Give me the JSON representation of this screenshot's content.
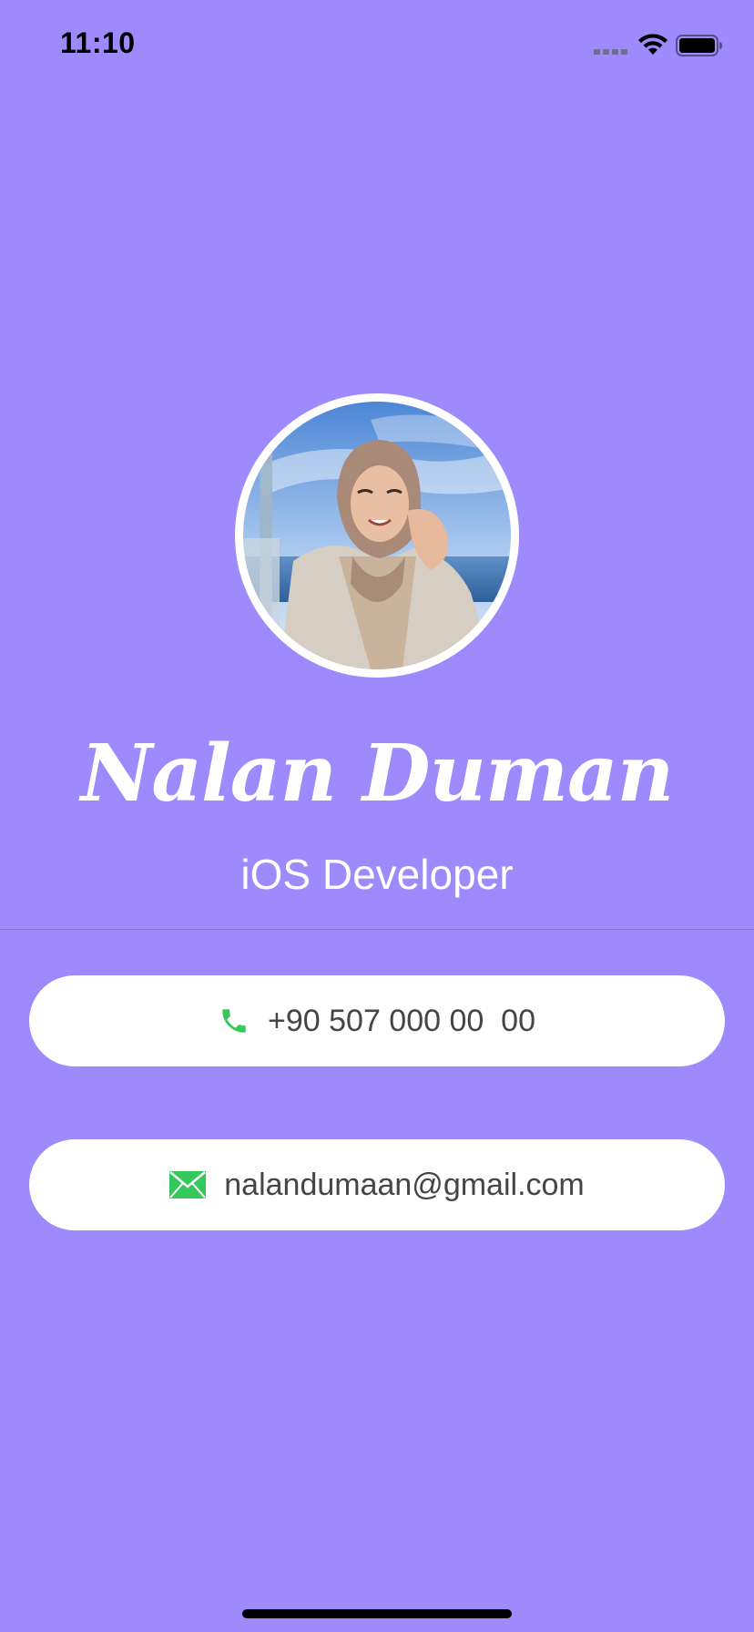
{
  "status_bar": {
    "time": "11:10"
  },
  "profile": {
    "name": "Nalan Duman",
    "title": "iOS Developer"
  },
  "contacts": {
    "phone": {
      "icon": "phone-icon",
      "value": "+90 507 000 00  00"
    },
    "email": {
      "icon": "envelope-icon",
      "value": "nalandumaan@gmail.com"
    }
  },
  "colors": {
    "background": "#9E8AFD",
    "card": "#FFFFFF",
    "text_on_background": "#FFFFFF",
    "contact_text": "#454545",
    "icon_green": "#34C759"
  }
}
